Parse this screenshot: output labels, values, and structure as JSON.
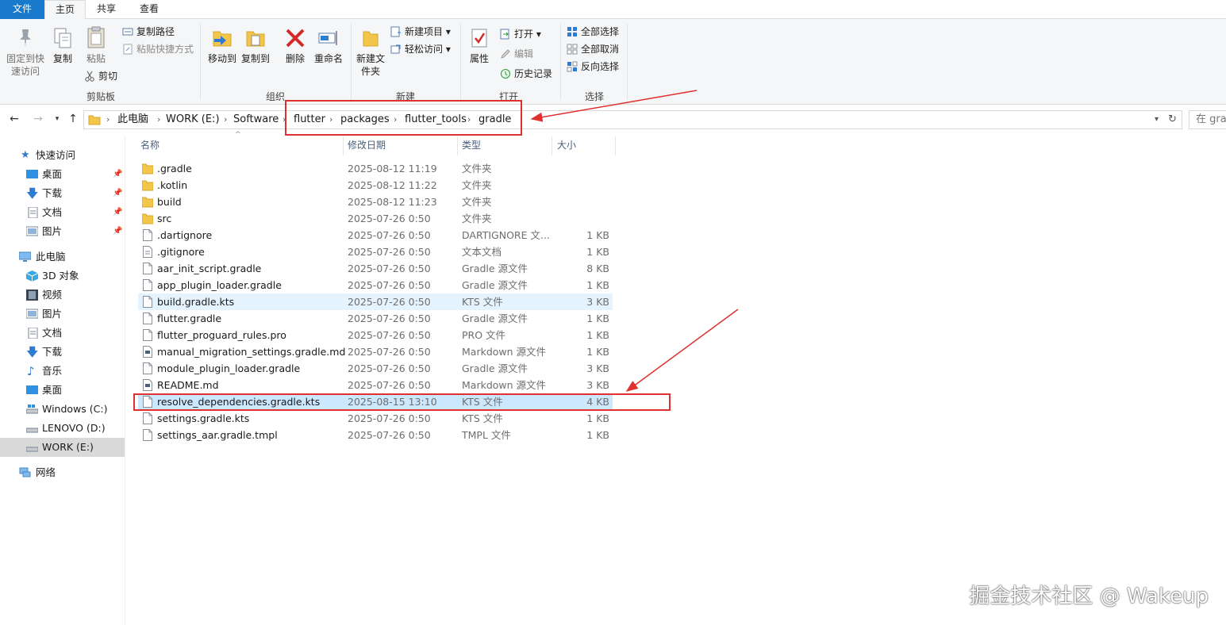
{
  "tabs": [
    {
      "label": "文件",
      "left": 0
    },
    {
      "label": "主页"
    },
    {
      "label": "共享"
    },
    {
      "label": "查看"
    }
  ],
  "ribbon": {
    "clipboard": {
      "pin_label": "固定到快速访问",
      "copy_label": "复制",
      "paste_label": "粘贴",
      "copy_path_label": "复制路径",
      "paste_shortcut_label": "粘贴快捷方式",
      "cut_label": "剪切",
      "group_label": "剪贴板"
    },
    "organize": {
      "move_to_label": "移动到",
      "copy_to_label": "复制到",
      "delete_label": "删除",
      "rename_label": "重命名",
      "group_label": "组织"
    },
    "new": {
      "new_folder_label": "新建文件夹",
      "new_item_label": "新建项目",
      "easy_access_label": "轻松访问",
      "group_label": "新建"
    },
    "open": {
      "properties_label": "属性",
      "open_label": "打开",
      "edit_label": "编辑",
      "history_label": "历史记录",
      "group_label": "打开"
    },
    "select": {
      "select_all_label": "全部选择",
      "select_none_label": "全部取消",
      "invert_label": "反向选择",
      "group_label": "选择"
    }
  },
  "address": {
    "crumbs": [
      "此电脑",
      "WORK (E:)",
      "Software",
      "flutter",
      "packages",
      "flutter_tools",
      "gradle"
    ],
    "search_placeholder": "在 gra"
  },
  "nav": {
    "quick_access": "快速访问",
    "quick_items": [
      "桌面",
      "下载",
      "文档",
      "图片"
    ],
    "this_pc": "此电脑",
    "pc_items": [
      "3D 对象",
      "视频",
      "图片",
      "文档",
      "下载",
      "音乐",
      "桌面",
      "Windows (C:)",
      "LENOVO (D:)",
      "WORK (E:)"
    ],
    "network": "网络"
  },
  "columns": {
    "name": "名称",
    "date": "修改日期",
    "type": "类型",
    "size": "大小"
  },
  "files": [
    {
      "name": ".gradle",
      "date": "2025-08-12 11:19",
      "type": "文件夹",
      "size": "",
      "kind": "folder"
    },
    {
      "name": ".kotlin",
      "date": "2025-08-12 11:22",
      "type": "文件夹",
      "size": "",
      "kind": "folder"
    },
    {
      "name": "build",
      "date": "2025-08-12 11:23",
      "type": "文件夹",
      "size": "",
      "kind": "folder"
    },
    {
      "name": "src",
      "date": "2025-07-26 0:50",
      "type": "文件夹",
      "size": "",
      "kind": "folder"
    },
    {
      "name": ".dartignore",
      "date": "2025-07-26 0:50",
      "type": "DARTIGNORE 文...",
      "size": "1 KB",
      "kind": "file"
    },
    {
      "name": ".gitignore",
      "date": "2025-07-26 0:50",
      "type": "文本文档",
      "size": "1 KB",
      "kind": "text"
    },
    {
      "name": "aar_init_script.gradle",
      "date": "2025-07-26 0:50",
      "type": "Gradle 源文件",
      "size": "8 KB",
      "kind": "file"
    },
    {
      "name": "app_plugin_loader.gradle",
      "date": "2025-07-26 0:50",
      "type": "Gradle 源文件",
      "size": "1 KB",
      "kind": "file"
    },
    {
      "name": "build.gradle.kts",
      "date": "2025-07-26 0:50",
      "type": "KTS 文件",
      "size": "3 KB",
      "kind": "file"
    },
    {
      "name": "flutter.gradle",
      "date": "2025-07-26 0:50",
      "type": "Gradle 源文件",
      "size": "1 KB",
      "kind": "file"
    },
    {
      "name": "flutter_proguard_rules.pro",
      "date": "2025-07-26 0:50",
      "type": "PRO 文件",
      "size": "1 KB",
      "kind": "file"
    },
    {
      "name": "manual_migration_settings.gradle.md",
      "date": "2025-07-26 0:50",
      "type": "Markdown 源文件",
      "size": "1 KB",
      "kind": "md"
    },
    {
      "name": "module_plugin_loader.gradle",
      "date": "2025-07-26 0:50",
      "type": "Gradle 源文件",
      "size": "3 KB",
      "kind": "file"
    },
    {
      "name": "README.md",
      "date": "2025-07-26 0:50",
      "type": "Markdown 源文件",
      "size": "3 KB",
      "kind": "md"
    },
    {
      "name": "resolve_dependencies.gradle.kts",
      "date": "2025-08-15 13:10",
      "type": "KTS 文件",
      "size": "4 KB",
      "kind": "file"
    },
    {
      "name": "settings.gradle.kts",
      "date": "2025-07-26 0:50",
      "type": "KTS 文件",
      "size": "1 KB",
      "kind": "file"
    },
    {
      "name": "settings_aar.gradle.tmpl",
      "date": "2025-07-26 0:50",
      "type": "TMPL 文件",
      "size": "1 KB",
      "kind": "file"
    }
  ],
  "watermark": "掘金技术社区 @ Wakeup",
  "colors": {
    "accent": "#1979ca",
    "annotation": "#e03030",
    "selected_row": "#cce8ff",
    "hover_row": "#e5f3ff"
  }
}
